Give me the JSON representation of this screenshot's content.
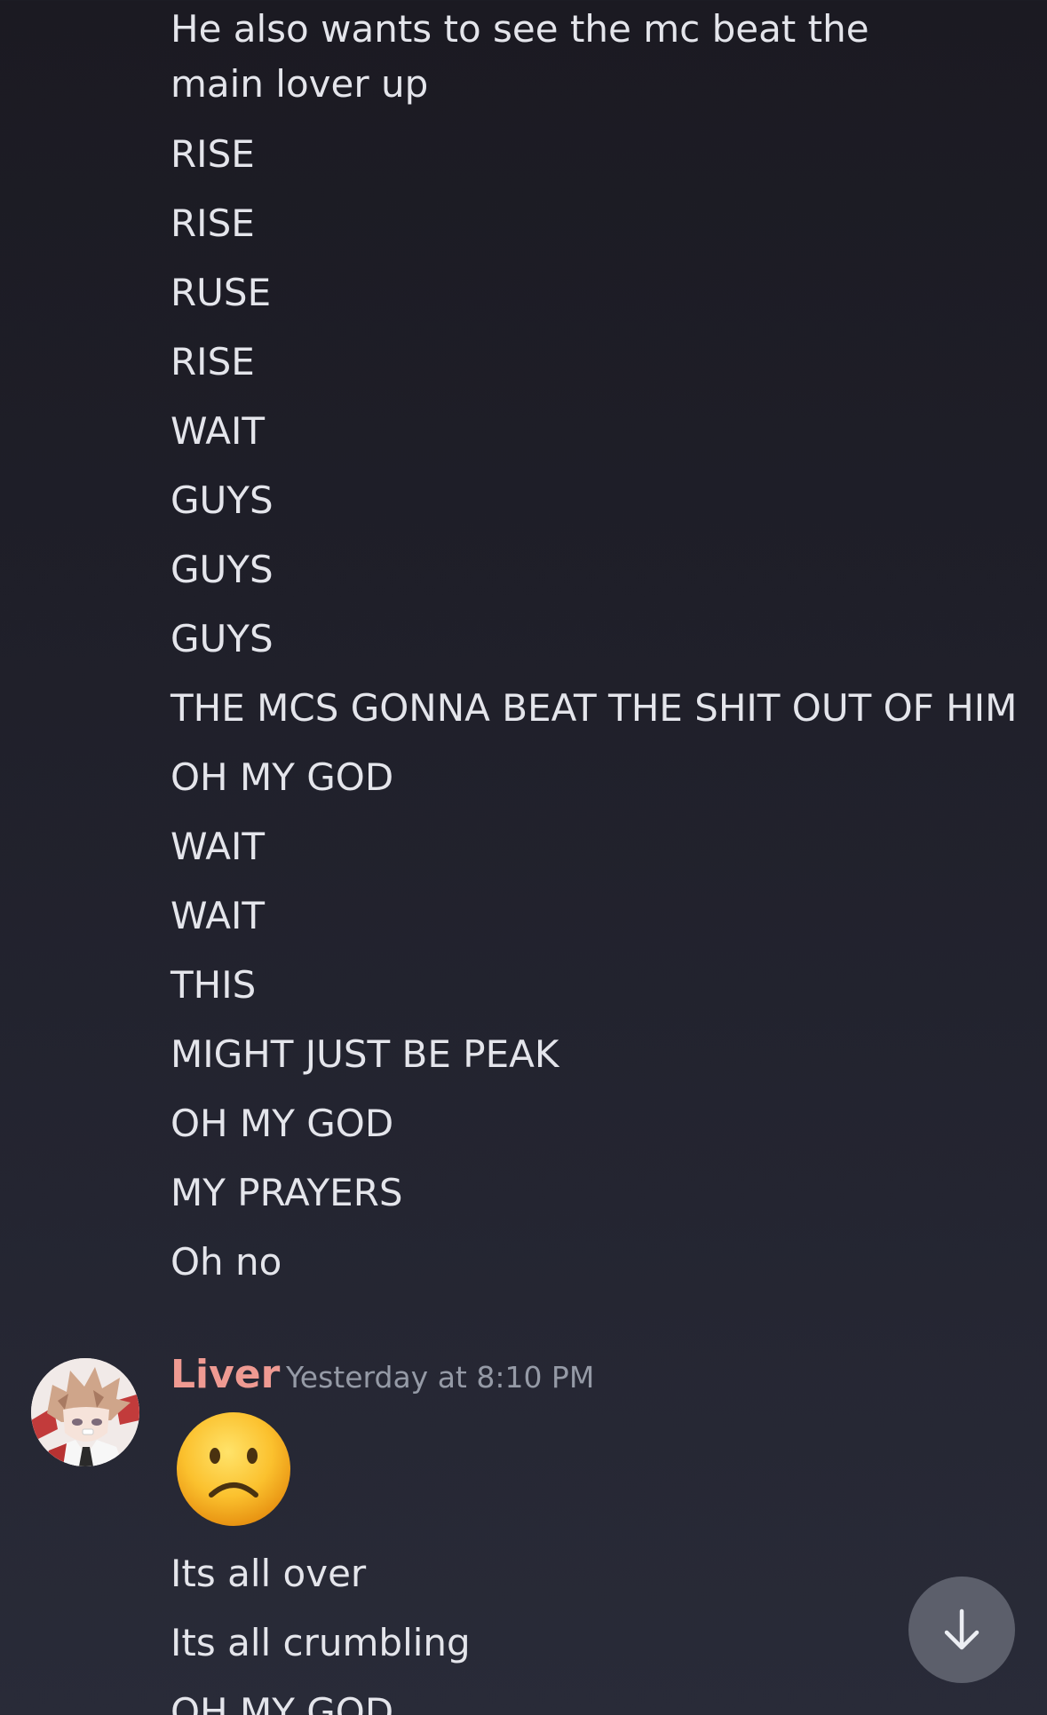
{
  "messages_prev": [
    "He also wants to see the mc beat the main lover up",
    "RISE",
    "RISE",
    "RUSE",
    "RISE",
    "WAIT",
    "GUYS",
    "GUYS",
    "GUYS",
    "THE MCS GONNA BEAT THE SHIT OUT OF HIM",
    "OH MY GOD",
    "WAIT",
    "WAIT",
    "THIS",
    "MIGHT JUST BE PEAK",
    "OH MY GOD",
    "MY PRAYERS",
    "Oh no"
  ],
  "author": {
    "name": "Liver",
    "timestamp": "Yesterday at 8:10 PM",
    "name_color": "#ef9a92"
  },
  "emoji": {
    "icon": "slightly-frowning-face-icon"
  },
  "messages_next": [
    "Its all over",
    "Its all crumbling",
    "OH MY GOD"
  ],
  "scroll_button": {
    "icon": "arrow-down-icon"
  }
}
